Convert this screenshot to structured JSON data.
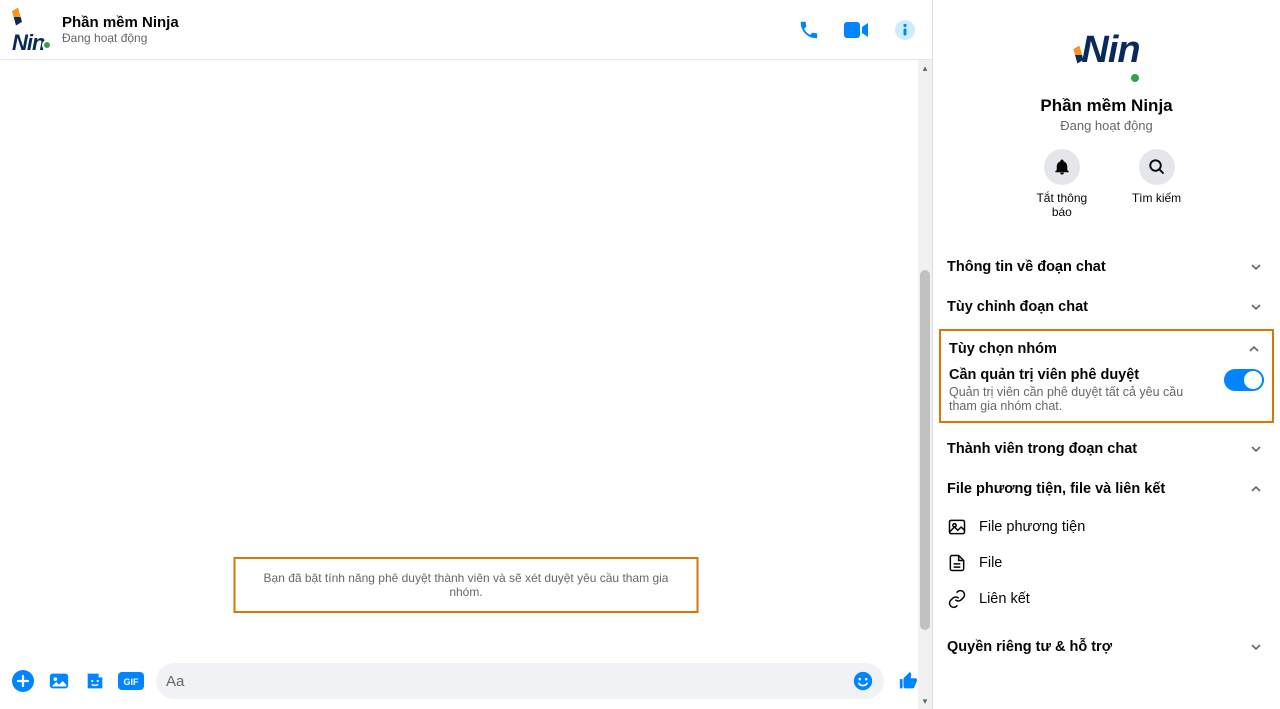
{
  "header": {
    "title": "Phần mềm Ninja",
    "status": "Đang hoạt động"
  },
  "systemMessage": "Bạn đã bật tính năng phê duyệt thành viên và sẽ xét duyệt yêu cầu tham gia nhóm.",
  "composer": {
    "placeholder": "Aa"
  },
  "sidebar": {
    "profile": {
      "title": "Phần mềm Ninja",
      "status": "Đang hoạt động",
      "actions": {
        "mute": "Tắt thông báo",
        "search": "Tìm kiếm"
      }
    },
    "sections": {
      "chatInfo": "Thông tin về đoạn chat",
      "customize": "Tùy chỉnh đoạn chat",
      "groupOptions": "Tùy chọn nhóm",
      "adminApproval": {
        "title": "Cần quản trị viên phê duyệt",
        "desc": "Quản trị viên cần phê duyệt tất cả yêu cầu tham gia nhóm chat."
      },
      "members": "Thành viên trong đoạn chat",
      "media": "File phương tiện, file và liên kết",
      "mediaItems": {
        "mediaFiles": "File phương tiện",
        "files": "File",
        "links": "Liên kết"
      },
      "privacy": "Quyền riêng tư & hỗ trợ"
    }
  }
}
